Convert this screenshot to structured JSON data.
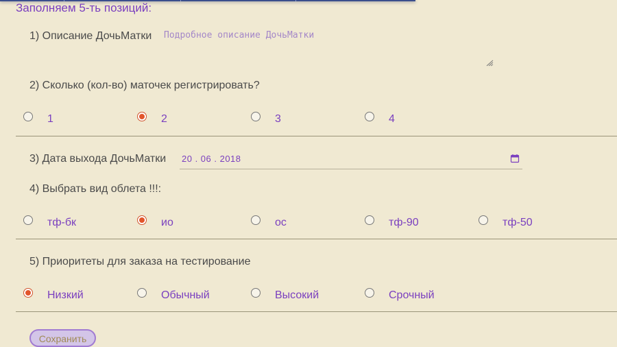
{
  "heading": "Заполняем 5-ть позиций:",
  "q1": {
    "label": "1) Описание ДочьМатки",
    "placeholder": "Подробное описание ДочьМатки"
  },
  "q2": {
    "label": "2) Сколько (кол-во) маточек регистрировать?",
    "options": [
      "1",
      "2",
      "3",
      "4"
    ],
    "selected": "2"
  },
  "q3": {
    "label": "3) Дата выхода ДочьМатки",
    "date_value": "20 . 06 . 2018",
    "calendar_icon": "calendar-icon"
  },
  "q4": {
    "label": "4) Выбрать вид облета !!!:",
    "options": [
      "тф-бк",
      "ио",
      "ос",
      "тф-90",
      "тф-50"
    ],
    "selected": "ио"
  },
  "q5": {
    "label": "5) Приоритеты для заказа на тестирование",
    "options": [
      "Низкий",
      "Обычный",
      "Высокий",
      "Срочный"
    ],
    "selected": "Низкий"
  },
  "save_label": "Сохранить",
  "colors": {
    "background": "#f0e9d2",
    "accent": "#7a3fbf",
    "radio_checked": "#e2552b"
  }
}
